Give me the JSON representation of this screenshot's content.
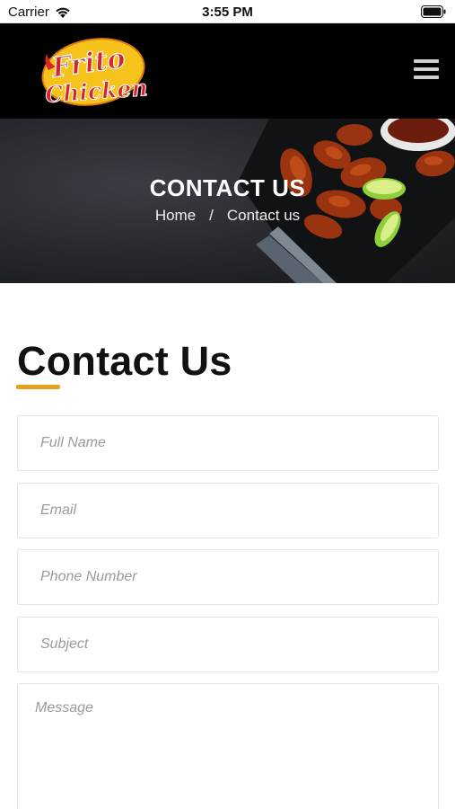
{
  "status_bar": {
    "carrier": "Carrier",
    "time": "3:55 PM"
  },
  "header": {
    "logo_top": "Frito",
    "logo_bottom": "Chicken"
  },
  "hero": {
    "title": "CONTACT US",
    "breadcrumb": {
      "home": "Home",
      "separator": "/",
      "current": "Contact us"
    }
  },
  "main": {
    "title": "Contact Us",
    "form": {
      "full_name_placeholder": "Full Name",
      "email_placeholder": "Email",
      "phone_placeholder": "Phone Number",
      "subject_placeholder": "Subject",
      "message_placeholder": "Message"
    }
  },
  "colors": {
    "accent": "#e8a11f",
    "header_bg": "#000000",
    "logo_red": "#d8232a",
    "logo_yellow": "#f6c21c"
  }
}
